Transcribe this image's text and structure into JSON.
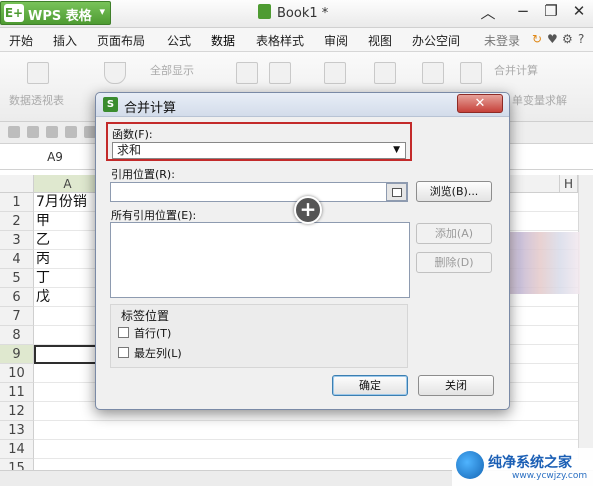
{
  "app": {
    "menu_button_label": "WPS 表格",
    "document_title": "Book1 *"
  },
  "menubar": {
    "items": [
      "开始",
      "插入",
      "页面布局",
      "公式",
      "数据",
      "表格样式",
      "审阅",
      "视图",
      "办公空间"
    ],
    "user_status": "未登录"
  },
  "ribbon": {
    "pivot_table": "数据透视表",
    "show_all": "全部显示",
    "consolidate": "合并计算",
    "single_var_solve": "单变量求解"
  },
  "formula_bar": {
    "name_box": "A9"
  },
  "grid": {
    "columns": [
      "A",
      "H"
    ],
    "rows": [
      {
        "num": "1",
        "a": "7月份销"
      },
      {
        "num": "2",
        "a": "甲"
      },
      {
        "num": "3",
        "a": "乙"
      },
      {
        "num": "4",
        "a": "丙"
      },
      {
        "num": "5",
        "a": "丁"
      },
      {
        "num": "6",
        "a": "戊"
      },
      {
        "num": "7",
        "a": ""
      },
      {
        "num": "8",
        "a": ""
      },
      {
        "num": "9",
        "a": ""
      },
      {
        "num": "10",
        "a": ""
      },
      {
        "num": "11",
        "a": ""
      },
      {
        "num": "12",
        "a": ""
      },
      {
        "num": "13",
        "a": ""
      },
      {
        "num": "14",
        "a": ""
      },
      {
        "num": "15",
        "a": ""
      }
    ],
    "active_cell": "A9"
  },
  "dialog": {
    "title": "合并计算",
    "function_label": "函数(F):",
    "function_value": "求和",
    "reference_label": "引用位置(R):",
    "reference_value": "",
    "browse_button": "浏览(B)...",
    "all_references_label": "所有引用位置(E):",
    "add_button": "添加(A)",
    "delete_button": "删除(D)",
    "label_position_title": "标签位置",
    "first_row_label": "首行(T)",
    "left_column_label": "最左列(L)",
    "ok_button": "确定",
    "close_button": "关闭",
    "first_row_checked": false,
    "left_column_checked": false
  },
  "watermark": {
    "name": "纯净系统之家",
    "url": "www.ycwjzy.com"
  }
}
